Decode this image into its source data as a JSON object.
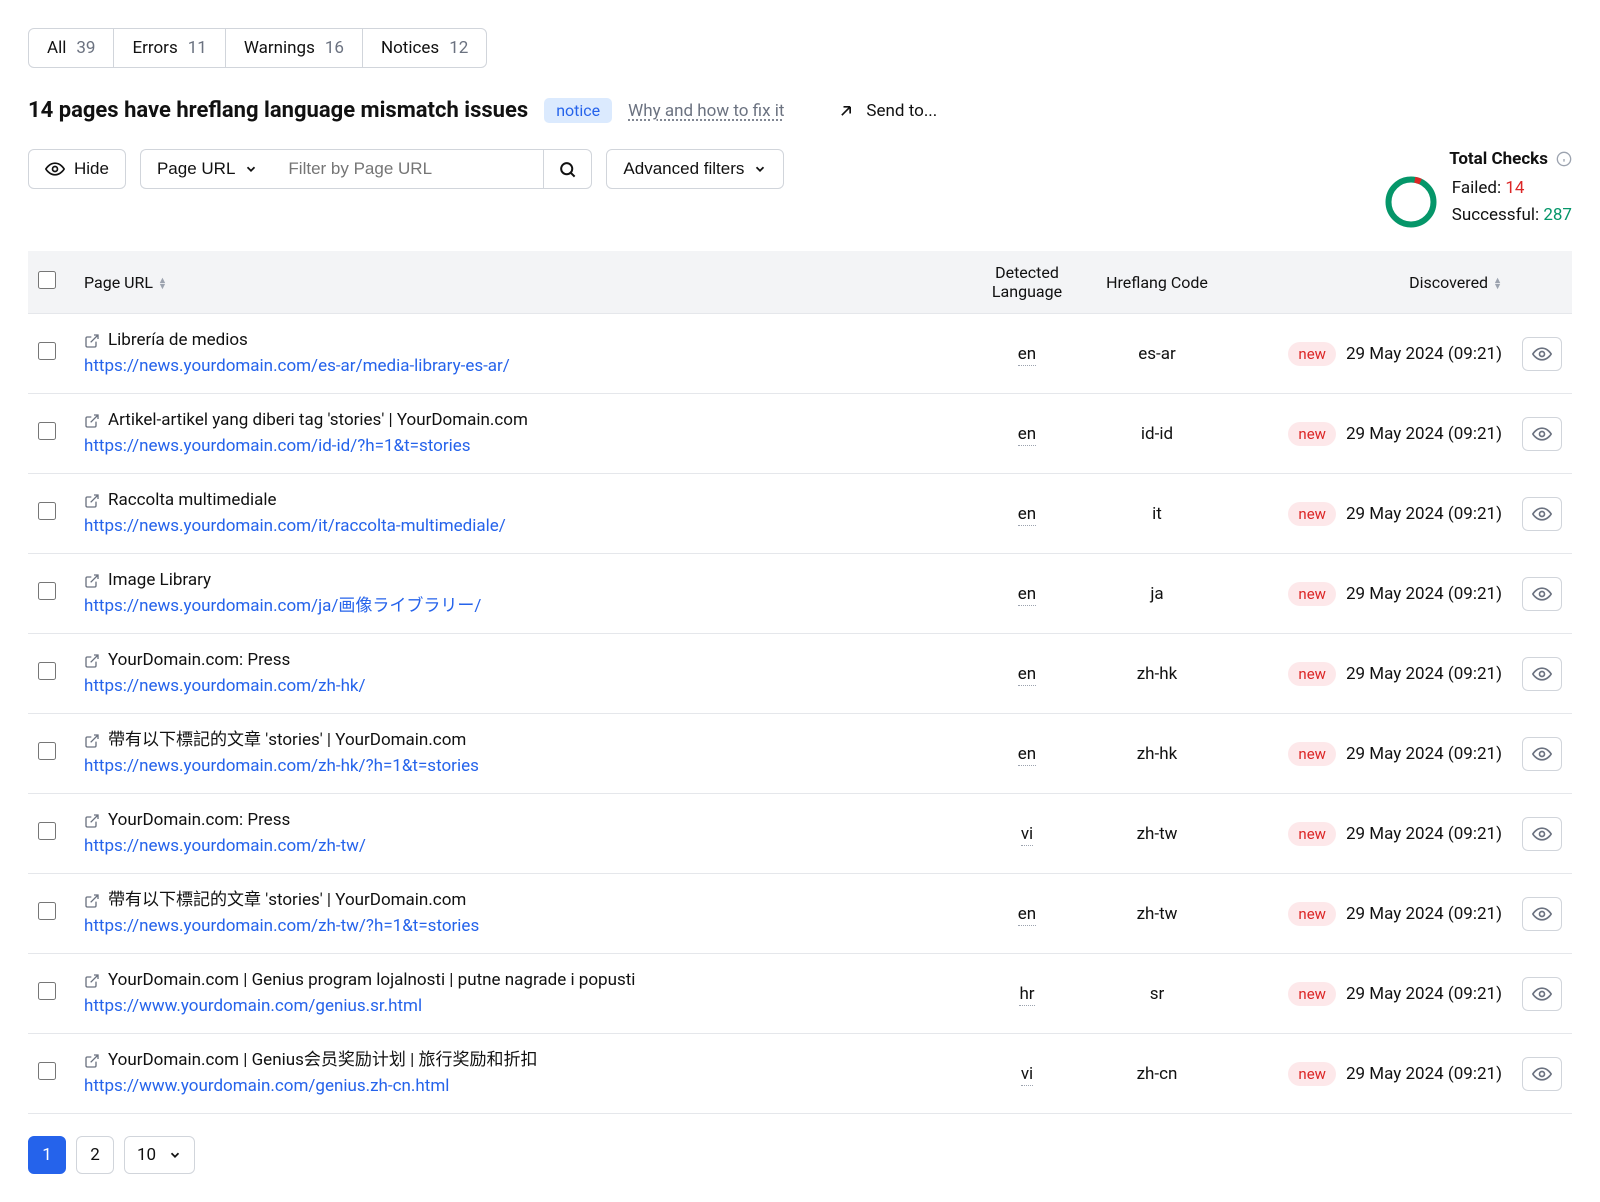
{
  "tabs": [
    {
      "label": "All",
      "count": 39
    },
    {
      "label": "Errors",
      "count": 11
    },
    {
      "label": "Warnings",
      "count": 16
    },
    {
      "label": "Notices",
      "count": 12
    }
  ],
  "header": {
    "title": "14 pages have hreflang language mismatch issues",
    "badge": "notice",
    "fix_link": "Why and how to fix it",
    "send_to": "Send to..."
  },
  "toolbar": {
    "hide": "Hide",
    "page_url_selector": "Page URL",
    "filter_placeholder": "Filter by Page URL",
    "advanced": "Advanced filters"
  },
  "totals": {
    "title": "Total Checks",
    "failed_label": "Failed:",
    "failed": 14,
    "success_label": "Successful:",
    "success": 287
  },
  "columns": {
    "page_url": "Page URL",
    "detected": "Detected Language",
    "hreflang": "Hreflang Code",
    "discovered": "Discovered"
  },
  "rows": [
    {
      "title": "Librería de medios",
      "url": "https://news.yourdomain.com/es-ar/media-library-es-ar/",
      "detected": "en",
      "hreflang": "es-ar",
      "new": "new",
      "discovered": "29 May 2024 (09:21)"
    },
    {
      "title": "Artikel-artikel yang diberi tag 'stories' | YourDomain.com",
      "url": "https://news.yourdomain.com/id-id/?h=1&t=stories",
      "detected": "en",
      "hreflang": "id-id",
      "new": "new",
      "discovered": "29 May 2024 (09:21)"
    },
    {
      "title": "Raccolta multimediale",
      "url": "https://news.yourdomain.com/it/raccolta-multimediale/",
      "detected": "en",
      "hreflang": "it",
      "new": "new",
      "discovered": "29 May 2024 (09:21)"
    },
    {
      "title": "Image Library",
      "url": "https://news.yourdomain.com/ja/画像ライブラリー/",
      "detected": "en",
      "hreflang": "ja",
      "new": "new",
      "discovered": "29 May 2024 (09:21)"
    },
    {
      "title": "YourDomain.com: Press",
      "url": "https://news.yourdomain.com/zh-hk/",
      "detected": "en",
      "hreflang": "zh-hk",
      "new": "new",
      "discovered": "29 May 2024 (09:21)"
    },
    {
      "title": "帶有以下標記的文章 'stories' | YourDomain.com",
      "url": "https://news.yourdomain.com/zh-hk/?h=1&t=stories",
      "detected": "en",
      "hreflang": "zh-hk",
      "new": "new",
      "discovered": "29 May 2024 (09:21)"
    },
    {
      "title": "YourDomain.com: Press",
      "url": "https://news.yourdomain.com/zh-tw/",
      "detected": "vi",
      "hreflang": "zh-tw",
      "new": "new",
      "discovered": "29 May 2024 (09:21)"
    },
    {
      "title": "帶有以下標記的文章 'stories' | YourDomain.com",
      "url": "https://news.yourdomain.com/zh-tw/?h=1&t=stories",
      "detected": "en",
      "hreflang": "zh-tw",
      "new": "new",
      "discovered": "29 May 2024 (09:21)"
    },
    {
      "title": "YourDomain.com | Genius program lojalnosti | putne nagrade i popusti",
      "url": "https://www.yourdomain.com/genius.sr.html",
      "detected": "hr",
      "hreflang": "sr",
      "new": "new",
      "discovered": "29 May 2024 (09:21)"
    },
    {
      "title": "YourDomain.com | Genius会员奖励计划 | 旅行奖励和折扣",
      "url": "https://www.yourdomain.com/genius.zh-cn.html",
      "detected": "vi",
      "hreflang": "zh-cn",
      "new": "new",
      "discovered": "29 May 2024 (09:21)"
    }
  ],
  "pagination": {
    "pages": [
      "1",
      "2"
    ],
    "active": 0,
    "page_size": "10"
  }
}
